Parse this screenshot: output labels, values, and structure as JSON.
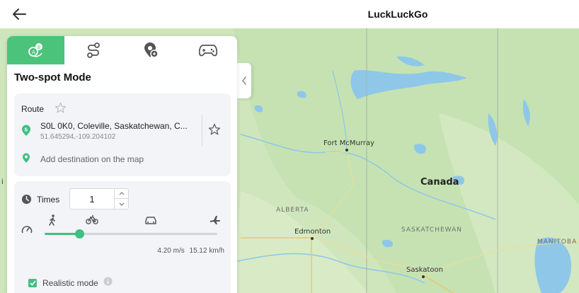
{
  "app": {
    "title": "LuckLuckGo"
  },
  "colors": {
    "accent": "#4bc37a",
    "slider": "#3fbf83",
    "map_land": "#cfe6bd",
    "map_water": "#8ec7e8"
  },
  "tabs": [
    {
      "name": "two-spot-mode",
      "icon": "two-spot-icon",
      "active": true
    },
    {
      "name": "multi-spot-mode",
      "icon": "route-icon",
      "active": false
    },
    {
      "name": "jump-teleport",
      "icon": "teleport-pin-icon",
      "active": false
    },
    {
      "name": "joystick",
      "icon": "gamepad-icon",
      "active": false
    }
  ],
  "panel": {
    "mode_title": "Two-spot Mode",
    "route": {
      "label": "Route",
      "start_address": "S0L 0K0, Coleville, Saskatchewan, C...",
      "start_coords": "51.645294,-109.204102",
      "start_badge": "S",
      "destination_placeholder": "Add destination on the map"
    },
    "times": {
      "label": "Times",
      "value": "1"
    },
    "speed": {
      "modes": [
        "walk-icon",
        "bike-icon",
        "car-icon",
        "plane-icon"
      ],
      "level": 0.2,
      "ms": "4.20 m/s",
      "kmh": "15.12 km/h"
    },
    "realistic_mode": {
      "label": "Realistic mode",
      "checked": true
    }
  },
  "map": {
    "labels": {
      "fort_mcmurray": "Fort McMurray",
      "canada": "Canada",
      "alberta": "ALBERTA",
      "edmonton": "Edmonton",
      "saskatchewan": "SASKATCHEWAN",
      "manitoba": "MANITOBA",
      "saskatoon": "Saskatoon",
      "left_cut": "i"
    }
  }
}
